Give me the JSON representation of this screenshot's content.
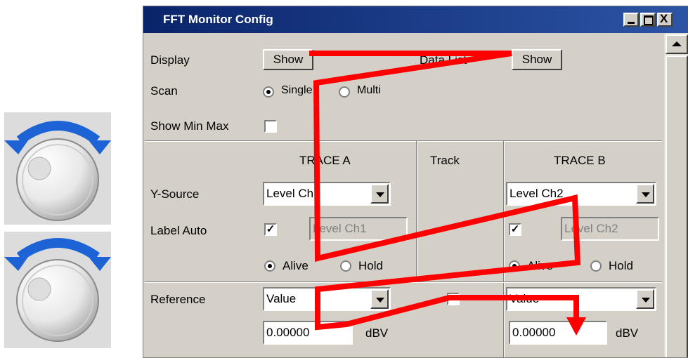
{
  "window": {
    "title": "FFT Monitor Config",
    "controls": {
      "minimize": "_",
      "maximize": "□",
      "close": "X"
    }
  },
  "display": {
    "label": "Display",
    "button": "Show"
  },
  "data_list": {
    "label": "Data List",
    "button": "Show"
  },
  "scan": {
    "label": "Scan",
    "options": [
      "Single",
      "Multi"
    ],
    "selected": "Single"
  },
  "show_min_max": {
    "label": "Show Min Max",
    "checked": false
  },
  "columns": {
    "trace_a": "TRACE A",
    "track": "Track",
    "trace_b": "TRACE B"
  },
  "y_source": {
    "label": "Y-Source",
    "trace_a": "Level Ch1",
    "trace_b": "Level Ch2"
  },
  "label_auto": {
    "label": "Label Auto",
    "trace_a_checked": true,
    "trace_a_text": "Level Ch1",
    "trace_b_checked": true,
    "trace_b_text": "Level Ch2"
  },
  "mode": {
    "options": [
      "Alive",
      "Hold"
    ],
    "trace_a_selected": "Alive",
    "trace_b_selected": "Alive"
  },
  "reference": {
    "label": "Reference",
    "trace_a": "Value",
    "trace_b": "Value",
    "track_checked": false,
    "trace_a_value": "0.00000",
    "trace_b_value": "0.00000",
    "unit": "dBV"
  },
  "colors": {
    "overlay_path": "#ff0000",
    "knob_arrow": "#1e63d6",
    "title_bar": "#0a246a"
  },
  "icons": [
    "rotary-knob-icon",
    "rotary-knob-icon"
  ]
}
